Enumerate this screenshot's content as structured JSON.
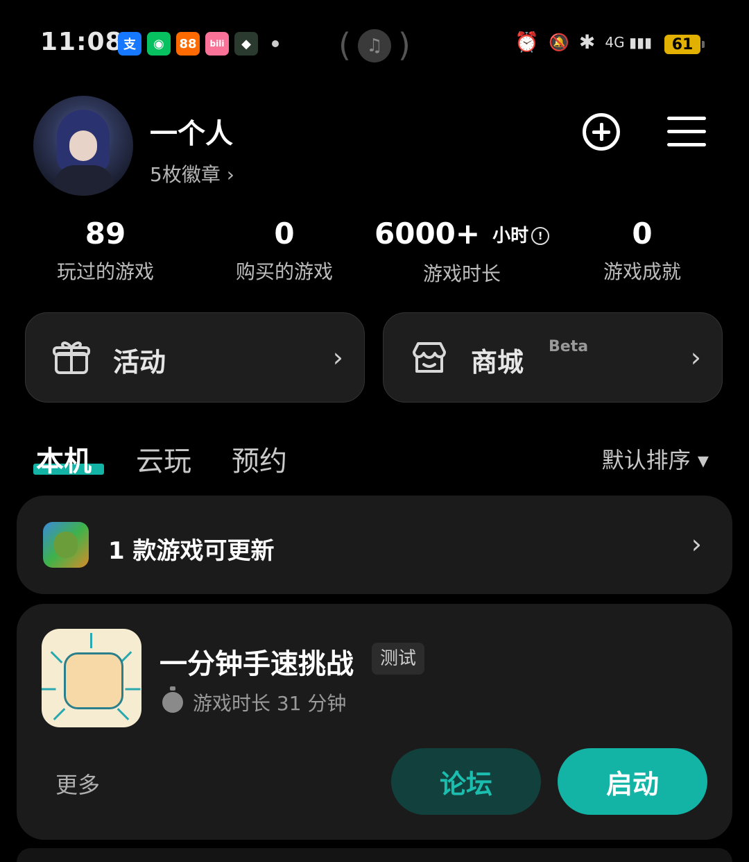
{
  "status_bar": {
    "time": "11:08",
    "notifications": [
      {
        "name": "alipay",
        "glyph": "支",
        "color": "#1677ff"
      },
      {
        "name": "wechat",
        "glyph": "◉",
        "color": "#07c160"
      },
      {
        "name": "app-orange",
        "glyph": "88",
        "color": "#ff6a00"
      },
      {
        "name": "bilibili",
        "glyph": "bili",
        "color": "#fb7299"
      },
      {
        "name": "app-green",
        "glyph": "◆",
        "color": "#2b3a2e"
      }
    ],
    "music_icon": "♫",
    "sys_icons": [
      "⏰",
      "🔕",
      "✱",
      "4G ▮▮▮"
    ],
    "battery": "61"
  },
  "profile": {
    "username": "一个人",
    "badges": "5枚徽章 ›"
  },
  "stats": [
    {
      "value": "89",
      "label": "玩过的游戏"
    },
    {
      "value": "0",
      "label": "购买的游戏"
    },
    {
      "value": "6000+",
      "unit": "小时",
      "info": "!",
      "label": "游戏时长"
    },
    {
      "value": "0",
      "label": "游戏成就"
    }
  ],
  "cards": {
    "activity": {
      "label": "活动",
      "chevron": "›"
    },
    "store": {
      "label": "商城",
      "beta": "Beta",
      "chevron": "›"
    }
  },
  "tabs": [
    {
      "label": "本机",
      "active": true
    },
    {
      "label": "云玩",
      "active": false
    },
    {
      "label": "预约",
      "active": false
    }
  ],
  "sort": {
    "label": "默认排序 ▾"
  },
  "update_bar": {
    "text": "1 款游戏可更新",
    "chevron": "›"
  },
  "game": {
    "title": "一分钟手速挑战",
    "tag": "测试",
    "playtime": "游戏时长 31 分钟",
    "more": "更多",
    "forum_button": "论坛",
    "start_button": "启动"
  },
  "colors": {
    "accent": "#13b3a6",
    "forum_bg": "#12403d",
    "card_bg": "#1e1e1e"
  }
}
